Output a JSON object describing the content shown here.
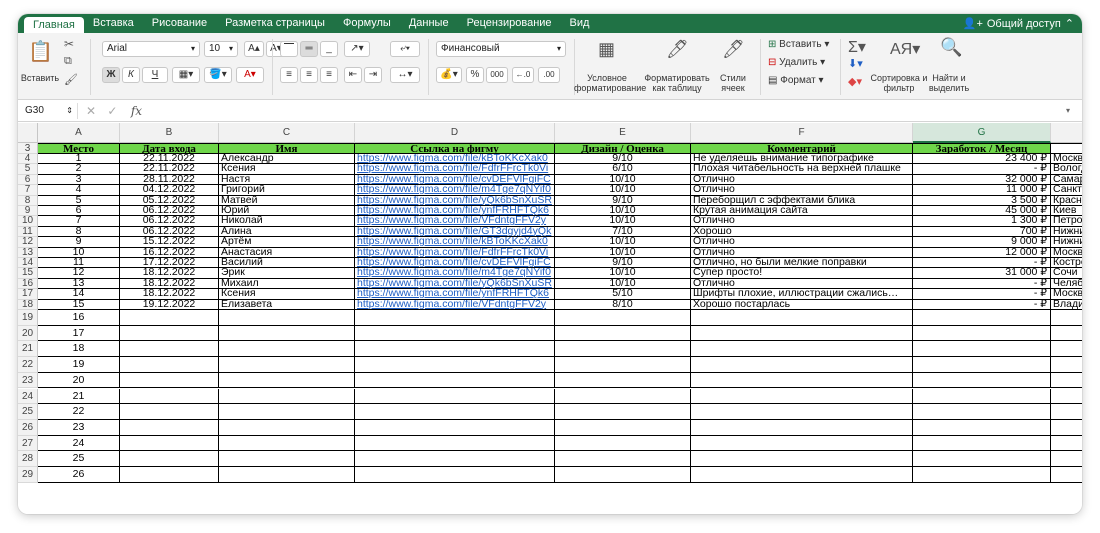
{
  "tabs": [
    "Главная",
    "Вставка",
    "Рисование",
    "Разметка страницы",
    "Формулы",
    "Данные",
    "Рецензирование",
    "Вид"
  ],
  "share_label": "Общий доступ",
  "ribbon": {
    "paste_label": "Вставить",
    "font_name": "Arial",
    "font_size": "10",
    "bold": "Ж",
    "italic": "К",
    "underline": "Ч",
    "number_format": "Финансовый",
    "percent": "%",
    "thousands": "000",
    "cond_format_label": "Условное форматирование",
    "format_table_label": "Форматировать как таблицу",
    "cell_styles_label": "Стили ячеек",
    "insert_label": "Вставить",
    "delete_label": "Удалить",
    "format_label": "Формат",
    "sort_label": "Сортировка и фильтр",
    "find_label": "Найти и выделить"
  },
  "formula_bar": {
    "name_box": "G30",
    "fx": "fx",
    "value": ""
  },
  "columns": [
    "A",
    "B",
    "C",
    "D",
    "E",
    "F",
    "G",
    ""
  ],
  "header_row_num": "3",
  "headers": [
    "Место",
    "Дата входа",
    "Имя",
    "Ссылка на фигму",
    "Дизайн / Оценка",
    "Комментарий",
    "Заработок / Месяц",
    ""
  ],
  "rows": [
    {
      "n": "4",
      "place": "1",
      "date": "22.11.2022",
      "name": "Александр",
      "link": "https://www.figma.com/file/kBToKKcXak0",
      "score": "9/10",
      "comment": "Не уделяешь внимание типографике",
      "earn": "23 400 ₽",
      "city": "Москва"
    },
    {
      "n": "5",
      "place": "2",
      "date": "22.11.2022",
      "name": "Ксения",
      "link": "https://www.figma.com/file/FdfrFFrcTk0Vi",
      "score": "6/10",
      "comment": "Плохая читабельность на верхней плашке",
      "earn": "-  ₽",
      "city": "Вологда"
    },
    {
      "n": "6",
      "place": "3",
      "date": "28.11.2022",
      "name": "Настя",
      "link": "https://www.figma.com/file/cvDEFVlFgiFC",
      "score": "10/10",
      "comment": "Отлично",
      "earn": "32 000 ₽",
      "city": "Самара"
    },
    {
      "n": "7",
      "place": "4",
      "date": "04.12.2022",
      "name": "Григорий",
      "link": "https://www.figma.com/file/m4Tge7qNYif0",
      "score": "10/10",
      "comment": "Отлично",
      "earn": "11 000 ₽",
      "city": "Санкт-Петербург"
    },
    {
      "n": "8",
      "place": "5",
      "date": "05.12.2022",
      "name": "Матвей",
      "link": "https://www.figma.com/file/yQk6bSnXuSR",
      "score": "9/10",
      "comment": "Переборщил с эффектами блика",
      "earn": "3 500 ₽",
      "city": "Краснодар"
    },
    {
      "n": "9",
      "place": "6",
      "date": "06.12.2022",
      "name": "Юрий",
      "link": "https://www.figma.com/file/ynfFRHFTQk6",
      "score": "10/10",
      "comment": "Крутая анимация сайта",
      "earn": "45 000 ₽",
      "city": "Киев"
    },
    {
      "n": "10",
      "place": "7",
      "date": "06.12.2022",
      "name": "Николай",
      "link": "https://www.figma.com/file/VFdntgFFV2y",
      "score": "10/10",
      "comment": "Отлично",
      "earn": "1 300 ₽",
      "city": "Петрозаводск"
    },
    {
      "n": "11",
      "place": "8",
      "date": "06.12.2022",
      "name": "Алина",
      "link": "https://www.figma.com/file/GT3dgyjd4yQk",
      "score": "7/10",
      "comment": "Хорошо",
      "earn": "700 ₽",
      "city": "Нижний Новгород"
    },
    {
      "n": "12",
      "place": "9",
      "date": "15.12.2022",
      "name": "Артём",
      "link": "https://www.figma.com/file/kBToKKcXak0",
      "score": "10/10",
      "comment": "Отлично",
      "earn": "9 000 ₽",
      "city": "Нижний Новгород"
    },
    {
      "n": "13",
      "place": "10",
      "date": "16.12.2022",
      "name": "Анастасия",
      "link": "https://www.figma.com/file/FdfrFFrcTk0Vi",
      "score": "10/10",
      "comment": "Отлично",
      "earn": "12 000 ₽",
      "city": "Москва"
    },
    {
      "n": "14",
      "place": "11",
      "date": "17.12.2022",
      "name": "Василий",
      "link": "https://www.figma.com/file/cvDEFVlFgiFC",
      "score": "9/10",
      "comment": "Отлично, но были мелкие поправки",
      "earn": "-  ₽",
      "city": "Кострома"
    },
    {
      "n": "15",
      "place": "12",
      "date": "18.12.2022",
      "name": "Эрик",
      "link": "https://www.figma.com/file/m4Tge7qNYif0",
      "score": "10/10",
      "comment": "Супер просто!",
      "earn": "31 000 ₽",
      "city": "Сочи"
    },
    {
      "n": "16",
      "place": "13",
      "date": "18.12.2022",
      "name": "Михаил",
      "link": "https://www.figma.com/file/yQk6bSnXuSR",
      "score": "10/10",
      "comment": "Отлично",
      "earn": "-  ₽",
      "city": "Челябинск"
    },
    {
      "n": "17",
      "place": "14",
      "date": "18.12.2022",
      "name": "Ксения",
      "link": "https://www.figma.com/file/ynfFRHFTQk6",
      "score": "5/10",
      "comment": "Шрифты плохие, иллюстрации сжались…",
      "earn": "-  ₽",
      "city": "Москва"
    },
    {
      "n": "18",
      "place": "15",
      "date": "19.12.2022",
      "name": "Елизавета",
      "link": "https://www.figma.com/file/VFdntgFFV2y",
      "score": "8/10",
      "comment": "Хорошо постарлась",
      "earn": "-  ₽",
      "city": "Владивосток"
    }
  ],
  "empty_rows": [
    {
      "n": "19",
      "place": "16"
    },
    {
      "n": "20",
      "place": "17"
    },
    {
      "n": "21",
      "place": "18"
    },
    {
      "n": "22",
      "place": "19"
    },
    {
      "n": "23",
      "place": "20"
    },
    {
      "n": "24",
      "place": "21"
    },
    {
      "n": "25",
      "place": "22"
    },
    {
      "n": "26",
      "place": "23"
    },
    {
      "n": "27",
      "place": "24"
    },
    {
      "n": "28",
      "place": "25"
    },
    {
      "n": "29",
      "place": "26"
    }
  ],
  "colors": {
    "accent": "#207245",
    "header_fill": "#6fd64a",
    "link": "#1f5fc5"
  }
}
